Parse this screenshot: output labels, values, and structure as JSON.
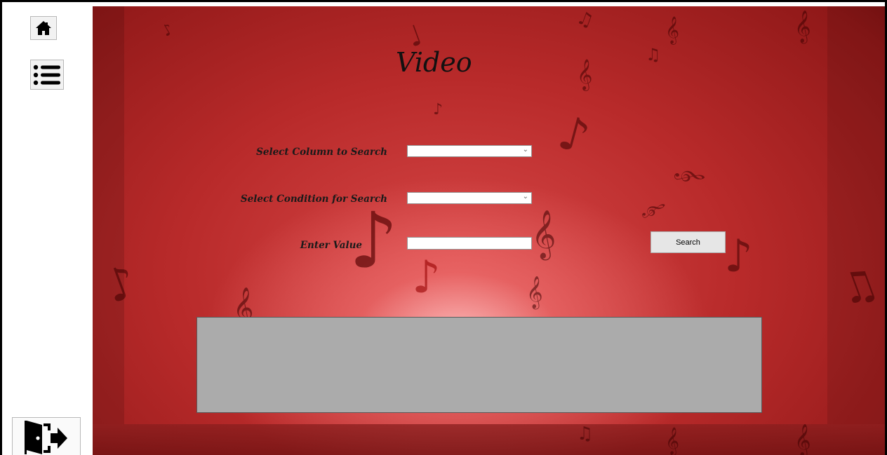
{
  "window": {
    "border_color": "#000000"
  },
  "sidebar": {
    "home_icon": "home-icon",
    "menu_icon": "list-menu-icon",
    "exit_icon": "exit-door-icon"
  },
  "page": {
    "title": "Video"
  },
  "form": {
    "column_label": "Select Column to Search",
    "column_value": "",
    "condition_label": "Select Condition for Search",
    "condition_value": "",
    "value_label": "Enter Value",
    "value_text": "",
    "search_label": "Search"
  },
  "results": {
    "rows": [],
    "background_color": "#ababab"
  },
  "theme": {
    "background_accent": "#c0392b"
  }
}
